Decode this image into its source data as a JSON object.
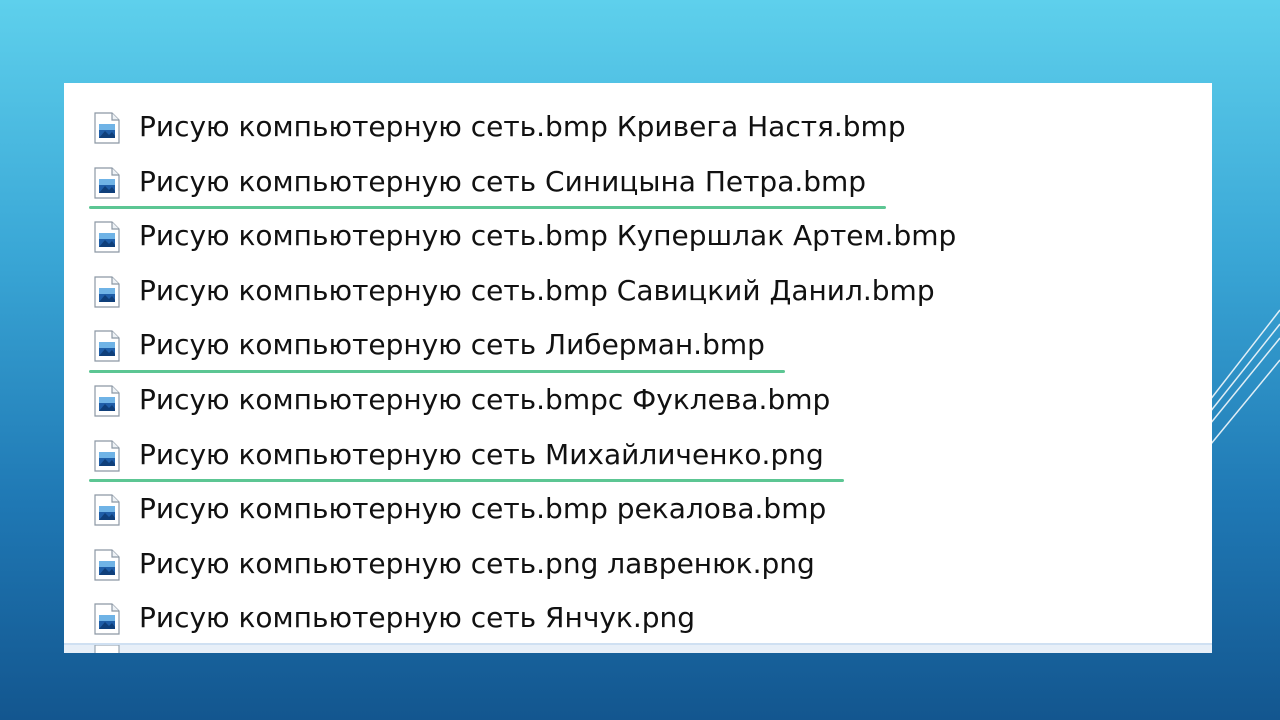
{
  "files": [
    {
      "name": "Рисую компьютерную сеть.bmp Кривега Настя.bmp",
      "icon": "bmp-file-icon",
      "underlined": false
    },
    {
      "name": "Рисую компьютерную сеть Синицына Петра.bmp",
      "icon": "bmp-file-icon",
      "underlined": true
    },
    {
      "name": "Рисую компьютерную сеть.bmp Купершлак Артем.bmp",
      "icon": "bmp-file-icon",
      "underlined": false
    },
    {
      "name": "Рисую компьютерную сеть.bmp Савицкий Данил.bmp",
      "icon": "bmp-file-icon",
      "underlined": false
    },
    {
      "name": "Рисую компьютерную сеть Либерман.bmp",
      "icon": "bmp-file-icon",
      "underlined": true
    },
    {
      "name": "Рисую компьютерную сеть.bmpс Фуклева.bmp",
      "icon": "bmp-file-icon",
      "underlined": false
    },
    {
      "name": "Рисую компьютерную сеть Михайличенко.png",
      "icon": "png-file-icon",
      "underlined": true
    },
    {
      "name": "Рисую компьютерную сеть.bmp рекалова.bmp",
      "icon": "bmp-file-icon",
      "underlined": false
    },
    {
      "name": "Рисую компьютерную сеть.png лавренюк.png",
      "icon": "png-file-icon",
      "underlined": false
    },
    {
      "name": "Рисую компьютерную сеть Янчук.png",
      "icon": "png-file-icon",
      "underlined": true
    }
  ],
  "colors": {
    "underline": "#5cc693",
    "selection": "#e7eff8",
    "background_top": "#5ed0ec",
    "background_bottom": "#13568f"
  }
}
